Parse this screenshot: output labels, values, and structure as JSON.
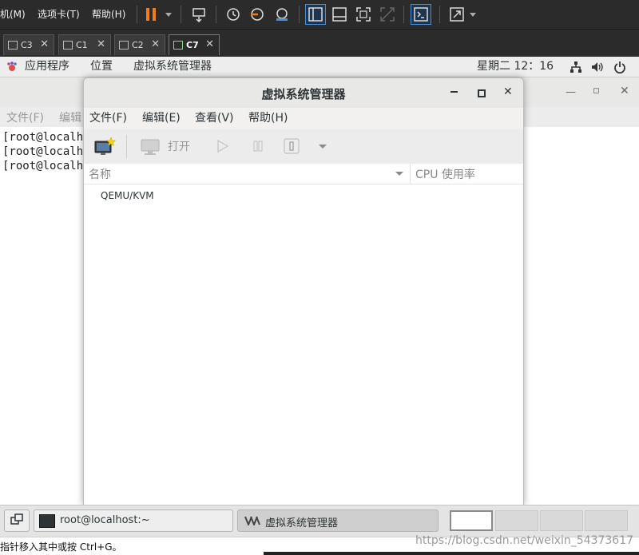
{
  "vmware": {
    "menus": [
      "机(M)",
      "选项卡(T)",
      "帮助(H)"
    ],
    "tabs": [
      {
        "label": "C3",
        "active": false
      },
      {
        "label": "C1",
        "active": false
      },
      {
        "label": "C2",
        "active": false
      },
      {
        "label": "C7",
        "active": true
      }
    ],
    "accent_color": "#f07d1a"
  },
  "gnome_topbar": {
    "applications": "应用程序",
    "places": "位置",
    "active_app": "虚拟系统管理器",
    "clock": "星期二 12：16"
  },
  "terminal": {
    "menu_items": [
      "文件(F)",
      "编辑"
    ],
    "lines": [
      "[root@localh",
      "[root@localh",
      "[root@localh"
    ]
  },
  "virt_manager": {
    "title": "虚拟系统管理器",
    "menus": [
      "文件(F)",
      "编辑(E)",
      "查看(V)",
      "帮助(H)"
    ],
    "toolbar": {
      "open_label": "打开"
    },
    "columns": {
      "name": "名称",
      "cpu": "CPU 使用率"
    },
    "connections": [
      "QEMU/KVM"
    ]
  },
  "taskbar": {
    "items": [
      {
        "label": "root@localhost:~",
        "active": false
      },
      {
        "label": "虚拟系统管理器",
        "active": true
      }
    ],
    "workspaces": 4,
    "active_workspace": 1
  },
  "statusbar": {
    "hint": "指针移入其中或按 Ctrl+G。",
    "watermark": "https://blog.csdn.net/weixin_54373617"
  }
}
